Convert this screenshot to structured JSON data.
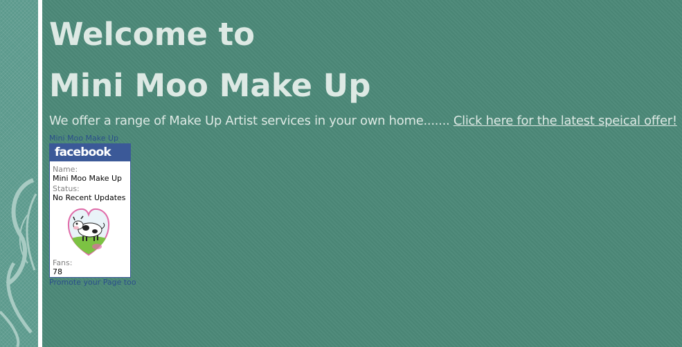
{
  "heading": {
    "line1": "Welcome to",
    "line2": "Mini Moo Make Up"
  },
  "intro": {
    "text": "We offer a range of Make Up Artist services in your own home....... ",
    "link": "Click here for the latest speical offer!"
  },
  "facebook": {
    "top_link": "Mini Moo Make Up",
    "brand": "facebook",
    "name_label": "Name:",
    "name_value": "Mini Moo Make Up",
    "status_label": "Status:",
    "status_value": "No Recent Updates",
    "fans_label": "Fans:",
    "fans_value": "78",
    "bottom_link": "Promote your Page too"
  },
  "colors": {
    "background": "#4b8877",
    "heading_text": "#dde9e4",
    "facebook_blue": "#3b5998"
  }
}
